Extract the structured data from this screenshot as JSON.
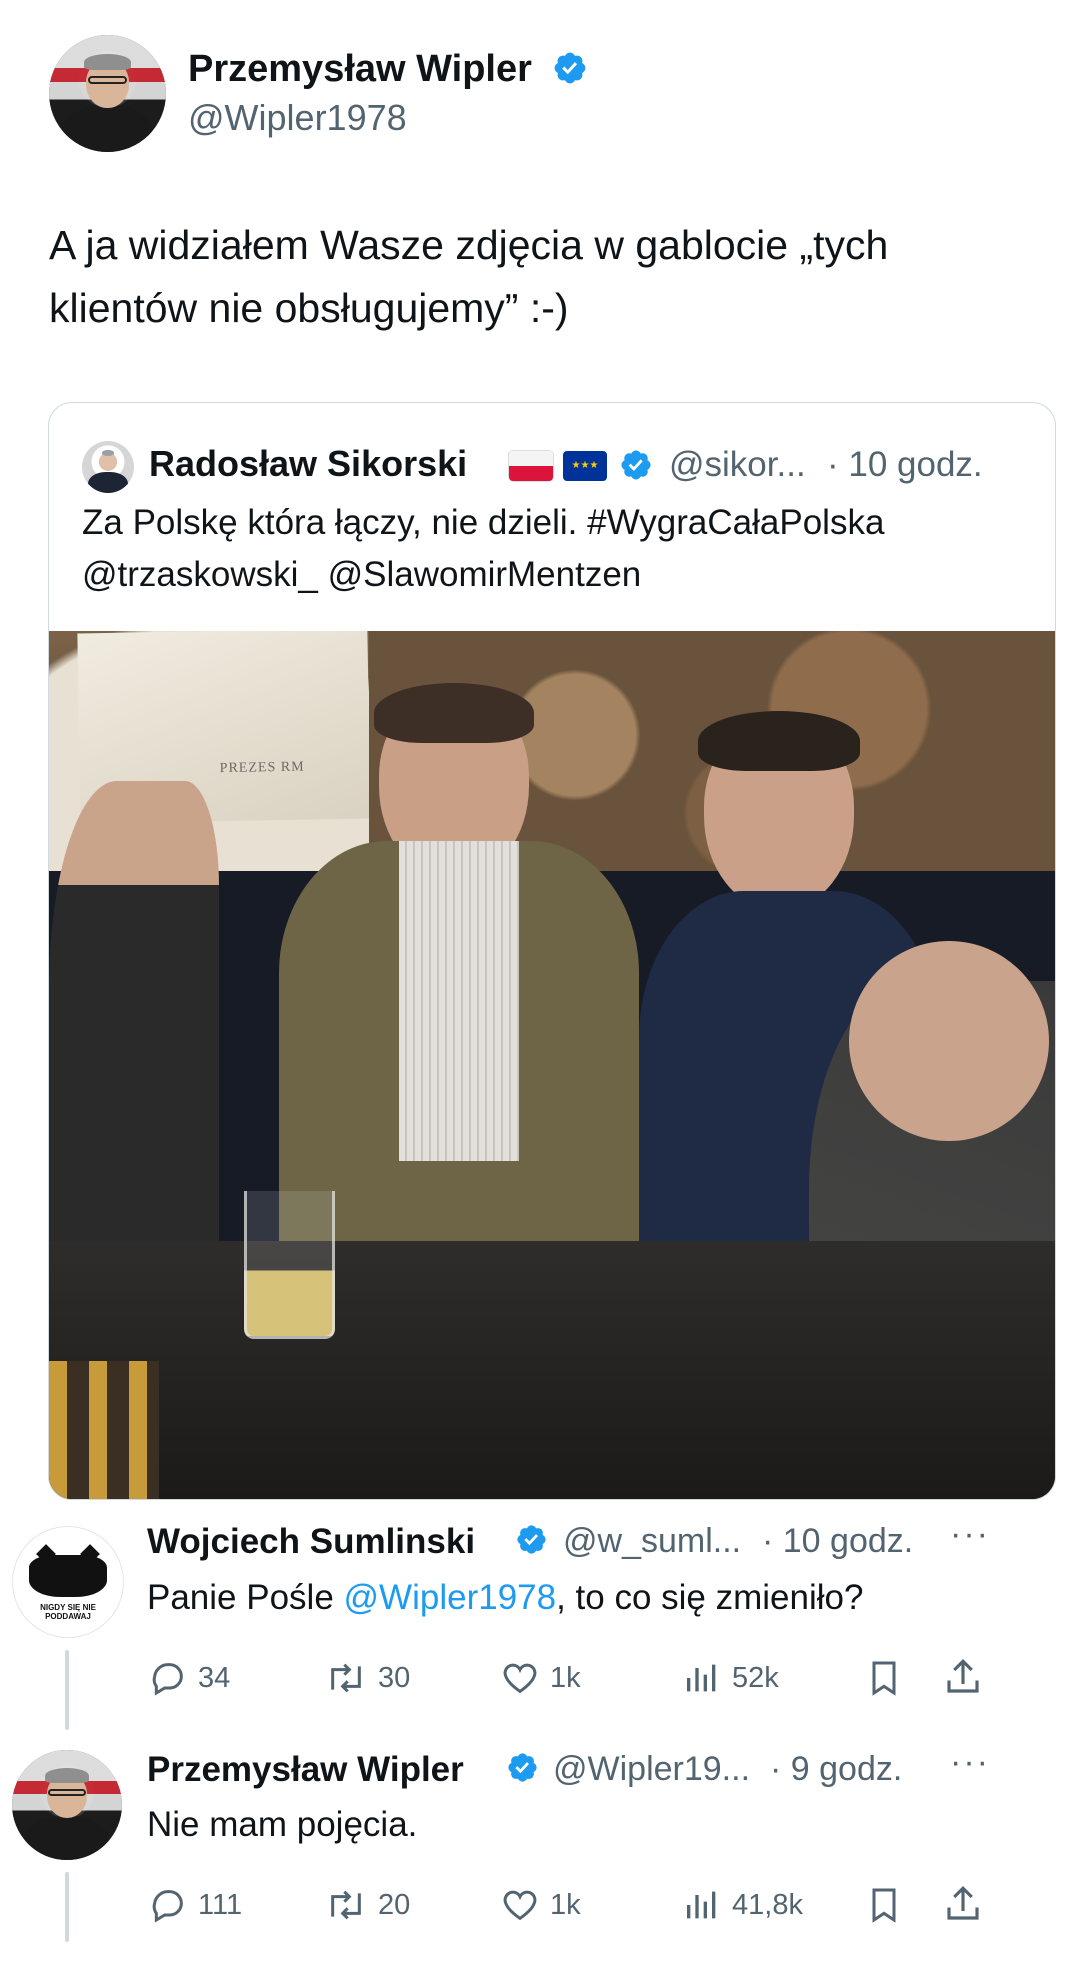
{
  "main_tweet": {
    "author_name": "Przemysław Wipler",
    "author_handle": "@Wipler1978",
    "text_line1": "A ja widziałem Wasze zdjęcia w gablocie „tych",
    "text_line2": "klientów nie obsługujemy” :-)"
  },
  "quote": {
    "author_name": "Radosław Sikorski",
    "flags": "🇵🇱 🇪🇺",
    "handle": "@sikor...",
    "time": "· 10 godz.",
    "text_line1": "Za Polskę która łączy, nie dzieli. #WygraCałaPolska",
    "text_line2": "@trzaskowski_ @SlawomirMentzen",
    "photo_caption": "PREZES RM"
  },
  "replies": [
    {
      "author_name": "Wojciech Sumlinski",
      "handle": "@w_suml...",
      "time": "· 10 godz.",
      "text_prefix": "Panie Pośle ",
      "mention": "@Wipler1978",
      "text_suffix": ", to co się zmieniło?",
      "avatar_text": "NIGDY SIĘ NIE PODDAWAJ",
      "replies_count": "34",
      "retweets_count": "30",
      "likes_count": "1k",
      "views_count": "52k"
    },
    {
      "author_name": "Przemysław Wipler",
      "handle": "@Wipler19...",
      "time": "· 9 godz.",
      "text": "Nie mam pojęcia.",
      "replies_count": "111",
      "retweets_count": "20",
      "likes_count": "1k",
      "views_count": "41,8k"
    }
  ],
  "colors": {
    "verified": "#1d9bf0",
    "link": "#1d9bf0",
    "muted": "#536471",
    "border": "#cfd9de"
  }
}
